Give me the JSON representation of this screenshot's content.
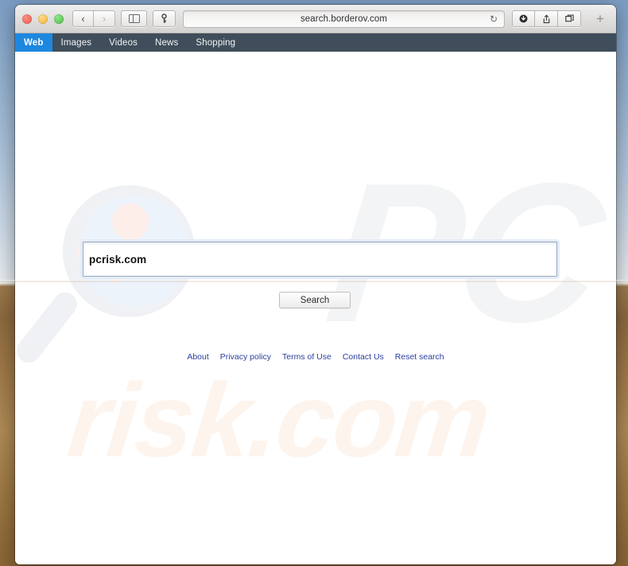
{
  "browser": {
    "window_controls": [
      {
        "name": "close",
        "color": "#ec6a5e"
      },
      {
        "name": "minimize",
        "color": "#f5bf4f"
      },
      {
        "name": "zoom",
        "color": "#61c555"
      }
    ],
    "back_glyph": "‹",
    "forward_glyph": "›",
    "sidebar_tooltip": "Show Sidebar",
    "key_glyph": "⚷",
    "address": {
      "url": "search.borderov.com",
      "placeholder": "Search or enter website name",
      "reload_glyph": "↻"
    },
    "right_buttons": [
      {
        "name": "downloads-icon",
        "glyph": "⬇"
      },
      {
        "name": "share-icon",
        "glyph": "↑"
      },
      {
        "name": "show-all-tabs-icon",
        "glyph": "❐"
      }
    ],
    "new_tab_glyph": "+"
  },
  "sitenav": {
    "items": [
      {
        "label": "Web",
        "active": true
      },
      {
        "label": "Images",
        "active": false
      },
      {
        "label": "Videos",
        "active": false
      },
      {
        "label": "News",
        "active": false
      },
      {
        "label": "Shopping",
        "active": false
      }
    ],
    "background_color": "#3f4e5a",
    "active_color": "#1e87e0"
  },
  "search": {
    "query": "pcrisk.com",
    "placeholder": "",
    "button_label": "Search"
  },
  "footer": {
    "links": [
      {
        "label": "About"
      },
      {
        "label": "Privacy policy"
      },
      {
        "label": "Terms of Use"
      },
      {
        "label": "Contact Us"
      },
      {
        "label": "Reset search"
      }
    ],
    "link_color": "#2b3f9e"
  },
  "watermarks": {
    "pc_text": "PC",
    "risk_text": "risk.com",
    "pc_color": "#f3f4f5",
    "risk_color": "#fdf4ee"
  }
}
